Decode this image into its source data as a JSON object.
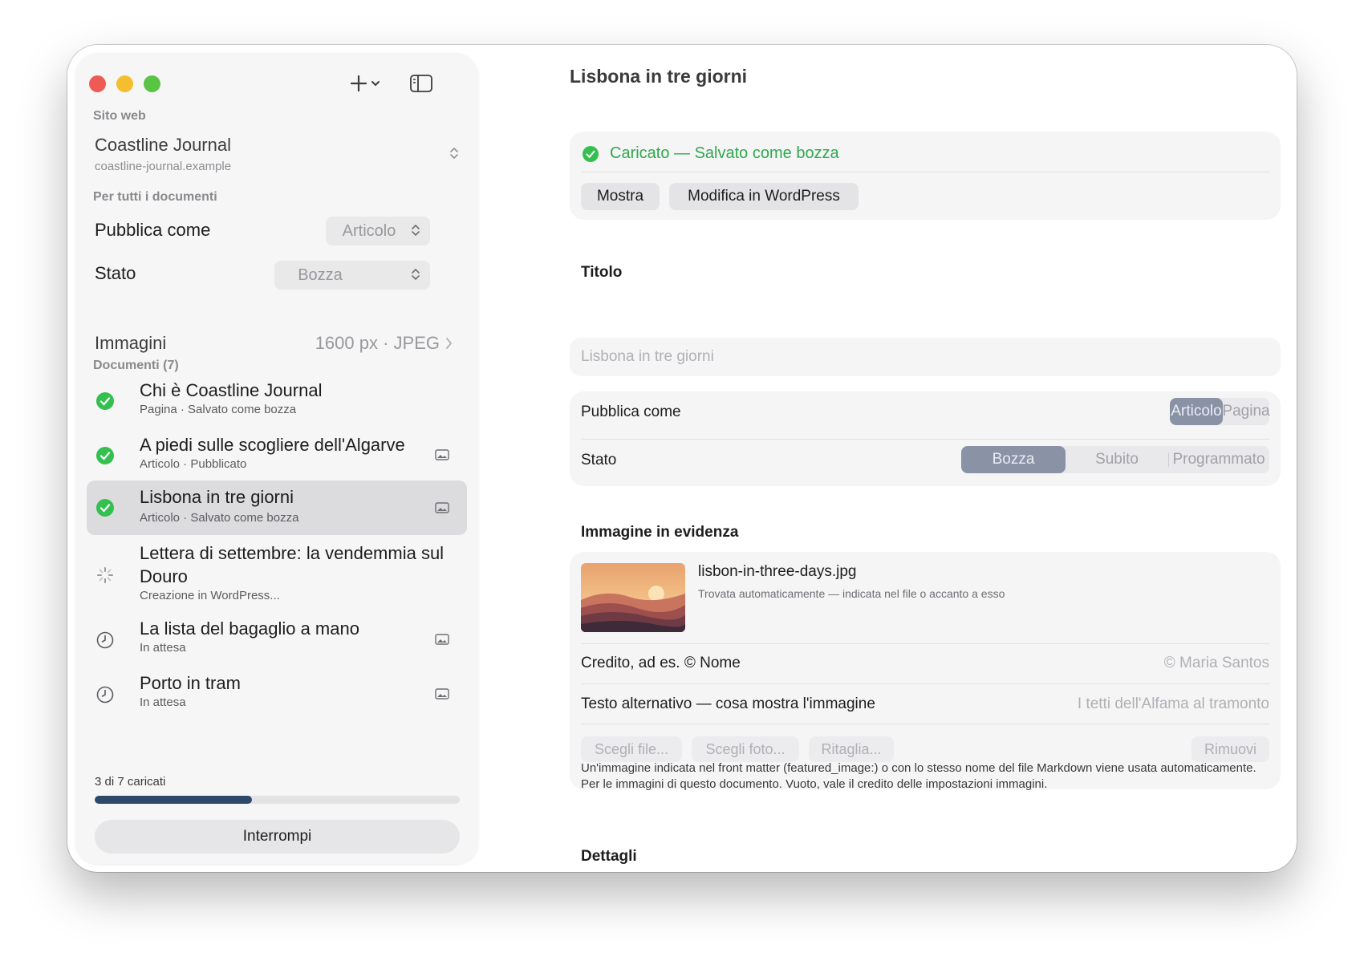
{
  "sidebar": {
    "site_section": "Sito web",
    "site_name": "Coastline Journal",
    "site_url": "coastline-journal.example",
    "all_docs_section": "Per tutti i documenti",
    "publish_as_label": "Pubblica come",
    "publish_as_value": "Articolo",
    "status_label": "Stato",
    "status_value": "Bozza",
    "images_label": "Immagini",
    "images_value": "1600 px · JPEG",
    "documents_section": "Documenti (7)",
    "documents": [
      {
        "title": "Chi è Coastline Journal",
        "sub": "Pagina · Salvato come bozza",
        "status": "done",
        "has_image": false
      },
      {
        "title": "A piedi sulle scogliere dell'Algarve",
        "sub": "Articolo · Pubblicato",
        "status": "done",
        "has_image": true
      },
      {
        "title": "Lisbona in tre giorni",
        "sub": "Articolo · Salvato come bozza",
        "status": "done",
        "has_image": true,
        "selected": true
      },
      {
        "title": "Lettera di settembre: la vendemmia sul Douro",
        "sub": "Creazione in WordPress...",
        "status": "loading",
        "has_image": false
      },
      {
        "title": "La lista del bagaglio a mano",
        "sub": "In attesa",
        "status": "pending",
        "has_image": true
      },
      {
        "title": "Porto in tram",
        "sub": "In attesa",
        "status": "pending",
        "has_image": true
      }
    ],
    "progress_text": "3 di 7 caricati",
    "progress_fraction": 0.43,
    "stop_button": "Interrompi"
  },
  "main": {
    "title": "Lisbona in tre giorni",
    "upload_status": "Caricato — Salvato come bozza",
    "show_button": "Mostra",
    "edit_button": "Modifica in WordPress",
    "title_section": "Titolo",
    "title_placeholder": "Lisbona in tre giorni",
    "publish_as_label": "Pubblica come",
    "publish_as_options": [
      "Articolo",
      "Pagina"
    ],
    "publish_as_selected": "Articolo",
    "status_label": "Stato",
    "status_options": [
      "Bozza",
      "Subito",
      "Programmato"
    ],
    "status_selected": "Bozza",
    "featured_section": "Immagine in evidenza",
    "featured_file": "lisbon-in-three-days.jpg",
    "featured_desc": "Trovata automaticamente — indicata nel file o accanto a esso",
    "credit_label": "Credito, ad es. © Nome",
    "credit_placeholder": "© Maria Santos",
    "alt_label": "Testo alternativo — cosa mostra l'immagine",
    "alt_placeholder": "I tetti dell'Alfama al tramonto",
    "choose_file": "Scegli file...",
    "choose_photo": "Scegli foto...",
    "crop": "Ritaglia...",
    "remove": "Rimuovi",
    "note": "Un'immagine indicata nel front matter (featured_image:) o con lo stesso nome del file Markdown viene usata automaticamente. Per le immagini di questo documento. Vuoto, vale il credito delle impostazioni immagini.",
    "details_section": "Dettagli"
  },
  "colors": {
    "accent_green": "#2fa84f",
    "progress": "#2d4868",
    "segment_active": "#8a93a6"
  }
}
